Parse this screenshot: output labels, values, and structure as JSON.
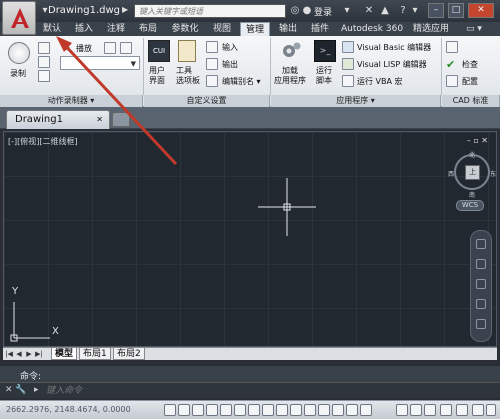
{
  "titlebar": {
    "file_name": "Drawing1.dwg",
    "search_placeholder": "键入关键字或短语",
    "login": "登录"
  },
  "tabs": [
    {
      "label": "默认"
    },
    {
      "label": "插入"
    },
    {
      "label": "注释"
    },
    {
      "label": "布局"
    },
    {
      "label": "参数化"
    },
    {
      "label": "视图"
    },
    {
      "label": "管理"
    },
    {
      "label": "输出"
    },
    {
      "label": "插件"
    },
    {
      "label": "Autodesk 360"
    },
    {
      "label": "精选应用"
    }
  ],
  "active_tab": "管理",
  "ribbon": {
    "record_label": "录制",
    "play_label": "播放",
    "action_recorder_panel": "动作录制器",
    "cui_text": "CUI",
    "user_interface_label": "用户\n界面",
    "tool_palettes_label": "工具\n选项板",
    "import_label": "输入",
    "export_label": "输出",
    "edit_aliases_label": "编辑别名",
    "customize_panel": "自定义设置",
    "load_app_label": "加载\n应用程序",
    "run_script_label": "运行\n脚本",
    "vb_editor_label": "Visual Basic 编辑器",
    "lisp_editor_label": "Visual LISP 编辑器",
    "run_vba_label": "运行 VBA 宏",
    "applications_panel": "应用程序",
    "check_label": "检查",
    "config_label": "配置",
    "cad_standards_panel": "CAD 标准"
  },
  "file_tab": {
    "label": "Drawing1"
  },
  "canvas": {
    "viewport_label": "[-][俯视][二维线框]",
    "viewcube_face": "上",
    "compass_n": "北",
    "compass_s": "南",
    "compass_e": "东",
    "compass_w": "西",
    "wcs_label": "WCS",
    "ucs_y": "Y",
    "ucs_x": "X"
  },
  "layout_tabs": [
    {
      "label": "模型",
      "active": true
    },
    {
      "label": "布局1",
      "active": false
    },
    {
      "label": "布局2",
      "active": false
    }
  ],
  "command": {
    "history_label": "命令:",
    "input_placeholder": "键入命令"
  },
  "statusbar": {
    "coordinates": "2662.2976, 2148.4674, 0.0000"
  },
  "colors": {
    "canvas_bg": "#212830",
    "annotation_arrow": "#c0392b",
    "titlebar": "#2c333c"
  }
}
